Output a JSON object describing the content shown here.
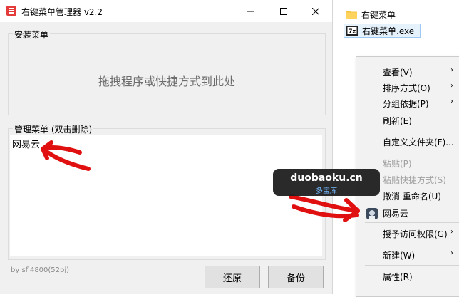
{
  "app": {
    "title": "右键菜单管理器 v2.2",
    "install_group_label": "安装菜单",
    "drop_hint": "拖拽程序或快捷方式到此处",
    "manage_group_label": "管理菜单 (双击删除)",
    "items": [
      "网易云"
    ],
    "author": "by sfl4800(52pj)",
    "restore_button": "还原",
    "backup_button": "备份"
  },
  "explorer": {
    "files": [
      {
        "name": "右键菜单",
        "icon": "folder-icon"
      },
      {
        "name": "右键菜单.exe",
        "icon": "exe-icon"
      }
    ]
  },
  "context_menu": {
    "items": [
      {
        "label": "查看(V)",
        "submenu": true
      },
      {
        "label": "排序方式(O)",
        "submenu": true
      },
      {
        "label": "分组依据(P)",
        "submenu": true
      },
      {
        "label": "刷新(E)"
      },
      {
        "label": "自定义文件夹(F)..."
      },
      {
        "label": "粘贴(P)",
        "disabled": true
      },
      {
        "label": "粘贴快捷方式(S)",
        "disabled": true
      },
      {
        "label": "撤消 重命名(U)"
      },
      {
        "label": "网易云"
      },
      {
        "label": "授予访问权限(G)",
        "submenu": true
      },
      {
        "label": "新建(W)",
        "submenu": true
      },
      {
        "label": "属性(R)"
      }
    ]
  },
  "watermark": {
    "main": "duobaoku.cn",
    "sub": "多宝库"
  },
  "colors": {
    "window_bg": "#f0f0f0",
    "annotation_red": "#e01010",
    "watermark_bg": "#1f1f1f",
    "watermark_sub": "#6db6ff"
  }
}
